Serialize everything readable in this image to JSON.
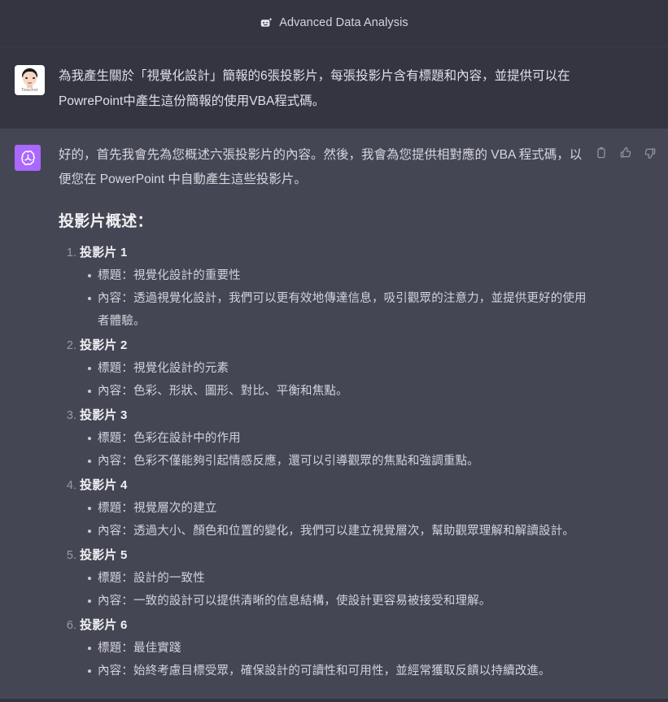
{
  "header": {
    "icon": "data-analysis-robot-icon",
    "title": "Advanced Data Analysis"
  },
  "conversation": {
    "user_turn": {
      "avatar": {
        "icon": "user-teacher-avatar",
        "caption": "Teacher"
      },
      "message": "為我產生關於「視覺化設計」簡報的6張投影片，每張投影片含有標題和內容，並提供可以在PowrePoint中產生這份簡報的使用VBA程式碼。"
    },
    "assistant_turn": {
      "avatar": {
        "icon": "openai-logo-icon",
        "bg_color": "#ab68ff"
      },
      "intro": "好的，首先我會先為您概述六張投影片的內容。然後，我會為您提供相對應的 VBA 程式碼，以便您在 PowerPoint 中自動產生這些投影片。",
      "actions": [
        {
          "name": "copy-icon",
          "label": "Copy"
        },
        {
          "name": "thumbs-up-icon",
          "label": "Good response"
        },
        {
          "name": "thumbs-down-icon",
          "label": "Bad response"
        }
      ],
      "heading": "投影片概述：",
      "slides": [
        {
          "name": "投影片 1",
          "bullets": [
            "標題：視覺化設計的重要性",
            "內容：透過視覺化設計，我們可以更有效地傳達信息，吸引觀眾的注意力，並提供更好的使用者體驗。"
          ]
        },
        {
          "name": "投影片 2",
          "bullets": [
            "標題：視覺化設計的元素",
            "內容：色彩、形狀、圖形、對比、平衡和焦點。"
          ]
        },
        {
          "name": "投影片 3",
          "bullets": [
            "標題：色彩在設計中的作用",
            "內容：色彩不僅能夠引起情感反應，還可以引導觀眾的焦點和強調重點。"
          ]
        },
        {
          "name": "投影片 4",
          "bullets": [
            "標題：視覺層次的建立",
            "內容：透過大小、顏色和位置的變化，我們可以建立視覺層次，幫助觀眾理解和解讀設計。"
          ]
        },
        {
          "name": "投影片 5",
          "bullets": [
            "標題：設計的一致性",
            "內容：一致的設計可以提供清晰的信息結構，使設計更容易被接受和理解。"
          ]
        },
        {
          "name": "投影片 6",
          "bullets": [
            "標題：最佳實踐",
            "內容：始終考慮目標受眾，確保設計的可讀性和可用性，並經常獲取反饋以持續改進。"
          ]
        }
      ]
    }
  },
  "theme": {
    "bg_user": "#343541",
    "bg_assistant": "#444654",
    "text_primary": "#d6d7dd",
    "accent_purple": "#ab68ff"
  }
}
